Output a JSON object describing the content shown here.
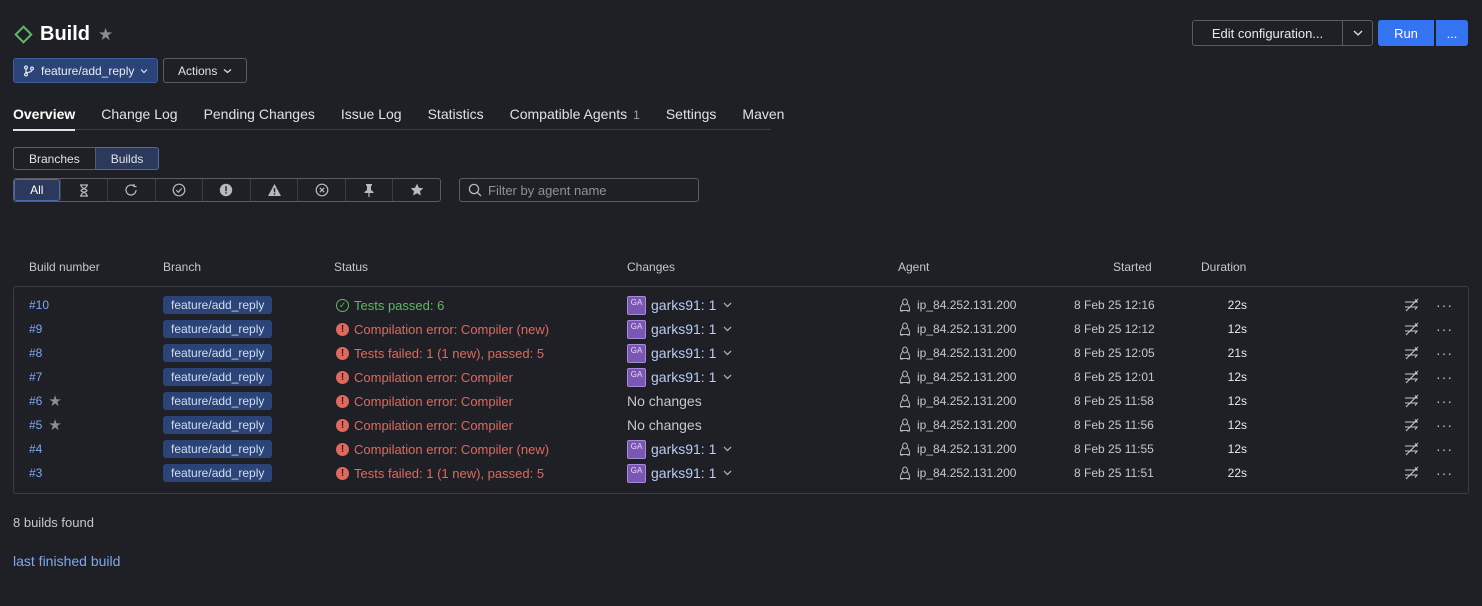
{
  "header": {
    "title": "Build",
    "branch": "feature/add_reply",
    "actions_label": "Actions",
    "edit_config_label": "Edit configuration...",
    "run_label": "Run",
    "more_label": "..."
  },
  "tabs": [
    {
      "label": "Overview",
      "active": true
    },
    {
      "label": "Change Log"
    },
    {
      "label": "Pending Changes"
    },
    {
      "label": "Issue Log"
    },
    {
      "label": "Statistics"
    },
    {
      "label": "Compatible Agents",
      "count": "1"
    },
    {
      "label": "Settings"
    },
    {
      "label": "Maven"
    }
  ],
  "view_toggle": {
    "branches": "Branches",
    "builds": "Builds"
  },
  "filters": {
    "all_label": "All",
    "icons": [
      "hourglass-icon",
      "running-icon",
      "success-icon",
      "failure-icon",
      "warning-icon",
      "cancelled-icon",
      "pin-icon",
      "star-icon"
    ]
  },
  "search": {
    "placeholder": "Filter by agent name",
    "value": ""
  },
  "table": {
    "headers": {
      "build_number": "Build number",
      "branch": "Branch",
      "status": "Status",
      "changes": "Changes",
      "agent": "Agent",
      "started": "Started",
      "duration": "Duration"
    },
    "rows": [
      {
        "number": "#10",
        "starred": false,
        "branch": "feature/add_reply",
        "status": "Tests passed: 6",
        "ok": true,
        "avatar": "GA",
        "changes": "garks91: 1",
        "agent": "ip_84.252.131.200",
        "started": "8 Feb 25 12:16",
        "duration": "22s"
      },
      {
        "number": "#9",
        "starred": false,
        "branch": "feature/add_reply",
        "status": "Compilation error: Compiler (new)",
        "ok": false,
        "avatar": "GA",
        "changes": "garks91: 1",
        "agent": "ip_84.252.131.200",
        "started": "8 Feb 25 12:12",
        "duration": "12s"
      },
      {
        "number": "#8",
        "starred": false,
        "branch": "feature/add_reply",
        "status": "Tests failed: 1 (1 new), passed: 5",
        "ok": false,
        "avatar": "GA",
        "changes": "garks91: 1",
        "agent": "ip_84.252.131.200",
        "started": "8 Feb 25 12:05",
        "duration": "21s"
      },
      {
        "number": "#7",
        "starred": false,
        "branch": "feature/add_reply",
        "status": "Compilation error: Compiler",
        "ok": false,
        "avatar": "GA",
        "changes": "garks91: 1",
        "agent": "ip_84.252.131.200",
        "started": "8 Feb 25 12:01",
        "duration": "12s"
      },
      {
        "number": "#6",
        "starred": true,
        "branch": "feature/add_reply",
        "status": "Compilation error: Compiler",
        "ok": false,
        "avatar": "",
        "changes": "No changes",
        "agent": "ip_84.252.131.200",
        "started": "8 Feb 25 11:58",
        "duration": "12s"
      },
      {
        "number": "#5",
        "starred": true,
        "branch": "feature/add_reply",
        "status": "Compilation error: Compiler",
        "ok": false,
        "avatar": "",
        "changes": "No changes",
        "agent": "ip_84.252.131.200",
        "started": "8 Feb 25 11:56",
        "duration": "12s"
      },
      {
        "number": "#4",
        "starred": false,
        "branch": "feature/add_reply",
        "status": "Compilation error: Compiler (new)",
        "ok": false,
        "avatar": "GA",
        "changes": "garks91: 1",
        "agent": "ip_84.252.131.200",
        "started": "8 Feb 25 11:55",
        "duration": "12s"
      },
      {
        "number": "#3",
        "starred": false,
        "branch": "feature/add_reply",
        "status": "Tests failed: 1 (1 new), passed: 5",
        "ok": false,
        "avatar": "GA",
        "changes": "garks91: 1",
        "agent": "ip_84.252.131.200",
        "started": "8 Feb 25 11:51",
        "duration": "22s"
      }
    ]
  },
  "footer": {
    "found_text": "8 builds found",
    "last_finished_link": "last finished build"
  },
  "colors": {
    "background": "#1f2025",
    "accent": "#3574f0",
    "success": "#5fb865",
    "error": "#e0685f",
    "link": "#7ea7f5"
  }
}
